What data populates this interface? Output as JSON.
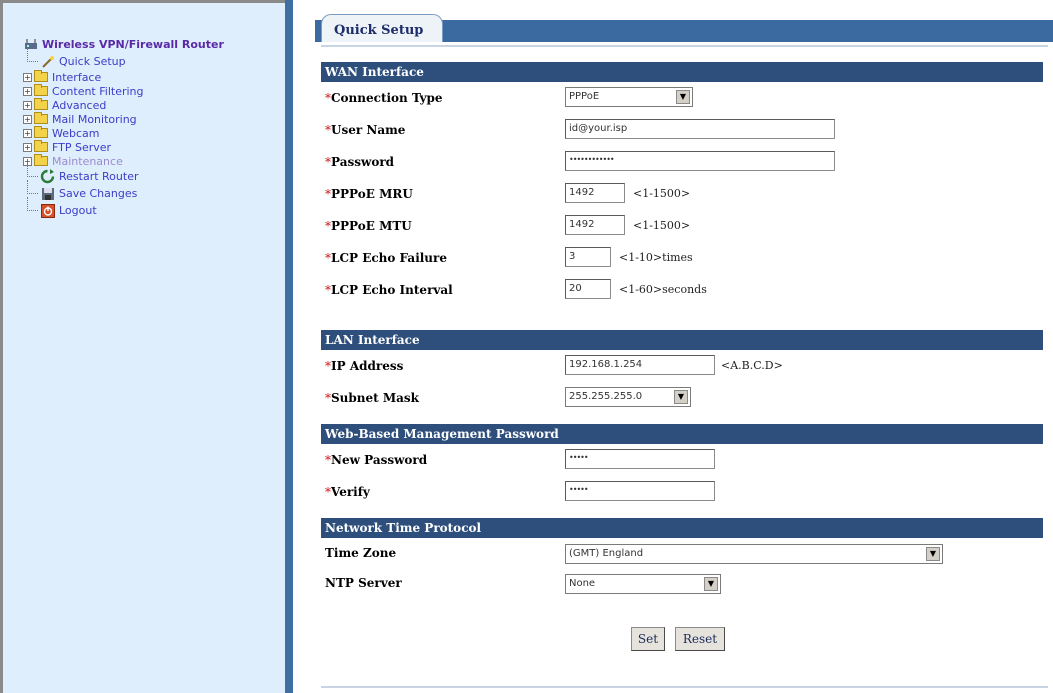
{
  "nav": {
    "root": "Wireless VPN/Firewall Router",
    "items": [
      {
        "label": "Quick Setup",
        "icon": "wand-icon"
      },
      {
        "label": "Interface",
        "icon": "folder-icon"
      },
      {
        "label": "Content Filtering",
        "icon": "folder-icon"
      },
      {
        "label": "Advanced",
        "icon": "folder-icon"
      },
      {
        "label": "Mail Monitoring",
        "icon": "folder-icon"
      },
      {
        "label": "Webcam",
        "icon": "folder-icon"
      },
      {
        "label": "FTP Server",
        "icon": "folder-icon"
      },
      {
        "label": "Maintenance",
        "icon": "folder-icon"
      },
      {
        "label": "Restart Router",
        "icon": "restart-icon"
      },
      {
        "label": "Save Changes",
        "icon": "save-icon"
      },
      {
        "label": "Logout",
        "icon": "logout-icon"
      }
    ]
  },
  "tab": {
    "label": "Quick Setup"
  },
  "sections": {
    "wan": "WAN Interface",
    "lan": "LAN Interface",
    "mgmt": "Web-Based Management Password",
    "ntp": "Network Time Protocol"
  },
  "wan": {
    "connection_type": {
      "label": "Connection Type",
      "value": "PPPoE"
    },
    "user_name": {
      "label": "User Name",
      "value": "id@your.isp"
    },
    "password": {
      "label": "Password",
      "value": "••••••••••••"
    },
    "pppoe_mru": {
      "label": "PPPoE MRU",
      "value": "1492",
      "hint": "<1-1500>"
    },
    "pppoe_mtu": {
      "label": "PPPoE MTU",
      "value": "1492",
      "hint": "<1-1500>"
    },
    "lcp_failure": {
      "label": "LCP Echo Failure",
      "value": "3",
      "hint": "<1-10>times"
    },
    "lcp_interval": {
      "label": "LCP Echo Interval",
      "value": "20",
      "hint": "<1-60>seconds"
    }
  },
  "lan": {
    "ip": {
      "label": "IP Address",
      "value": "192.168.1.254",
      "hint": "<A.B.C.D>"
    },
    "mask": {
      "label": "Subnet Mask",
      "value": "255.255.255.0"
    }
  },
  "mgmt": {
    "new_password": {
      "label": "New Password",
      "value": "•••••"
    },
    "verify": {
      "label": "Verify",
      "value": "•••••"
    }
  },
  "ntp": {
    "time_zone": {
      "label": "Time Zone",
      "value": "(GMT) England"
    },
    "server": {
      "label": "NTP Server",
      "value": "None"
    }
  },
  "buttons": {
    "set": "Set",
    "reset": "Reset"
  },
  "required_mark": "*"
}
